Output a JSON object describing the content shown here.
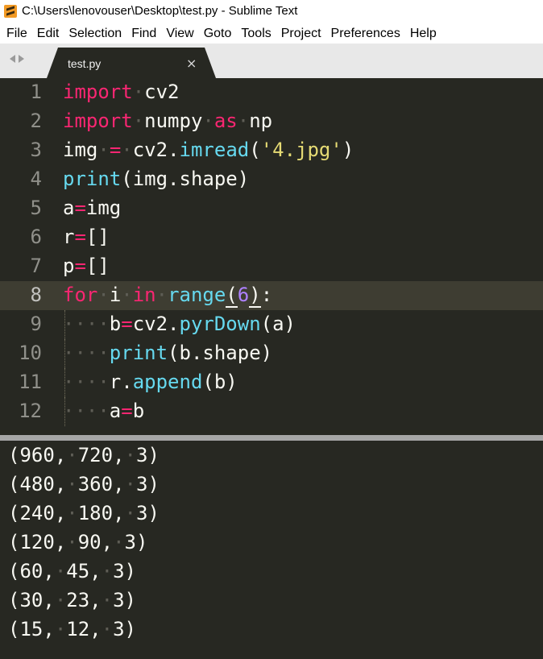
{
  "window": {
    "title": "C:\\Users\\lenovouser\\Desktop\\test.py - Sublime Text",
    "icon": "sublime-text-icon"
  },
  "menu": [
    "File",
    "Edit",
    "Selection",
    "Find",
    "View",
    "Goto",
    "Tools",
    "Project",
    "Preferences",
    "Help"
  ],
  "tabs": {
    "active": {
      "label": "test.py",
      "close": "×"
    }
  },
  "editor": {
    "active_line": 8,
    "lines": [
      {
        "num": "1",
        "text": "import cv2"
      },
      {
        "num": "2",
        "text": "import numpy as np"
      },
      {
        "num": "3",
        "text": "img = cv2.imread('4.jpg')"
      },
      {
        "num": "4",
        "text": "print(img.shape)"
      },
      {
        "num": "5",
        "text": "a=img"
      },
      {
        "num": "6",
        "text": "r=[]"
      },
      {
        "num": "7",
        "text": "p=[]"
      },
      {
        "num": "8",
        "text": "for i in range(6):"
      },
      {
        "num": "9",
        "text": "    b=cv2.pyrDown(a)"
      },
      {
        "num": "10",
        "text": "    print(b.shape)"
      },
      {
        "num": "11",
        "text": "    r.append(b)"
      },
      {
        "num": "12",
        "text": "    a=b"
      }
    ]
  },
  "output": {
    "lines": [
      "(960, 720, 3)",
      "(480, 360, 3)",
      "(240, 180, 3)",
      "(120, 90, 3)",
      "(60, 45, 3)",
      "(30, 23, 3)",
      "(15, 12, 3)"
    ]
  },
  "colors": {
    "background": "#272822",
    "keyword": "#f92672",
    "function": "#66d9ef",
    "number": "#ae81ff",
    "string": "#e6db74",
    "text": "#f8f8f2",
    "line_number": "#90908a"
  }
}
